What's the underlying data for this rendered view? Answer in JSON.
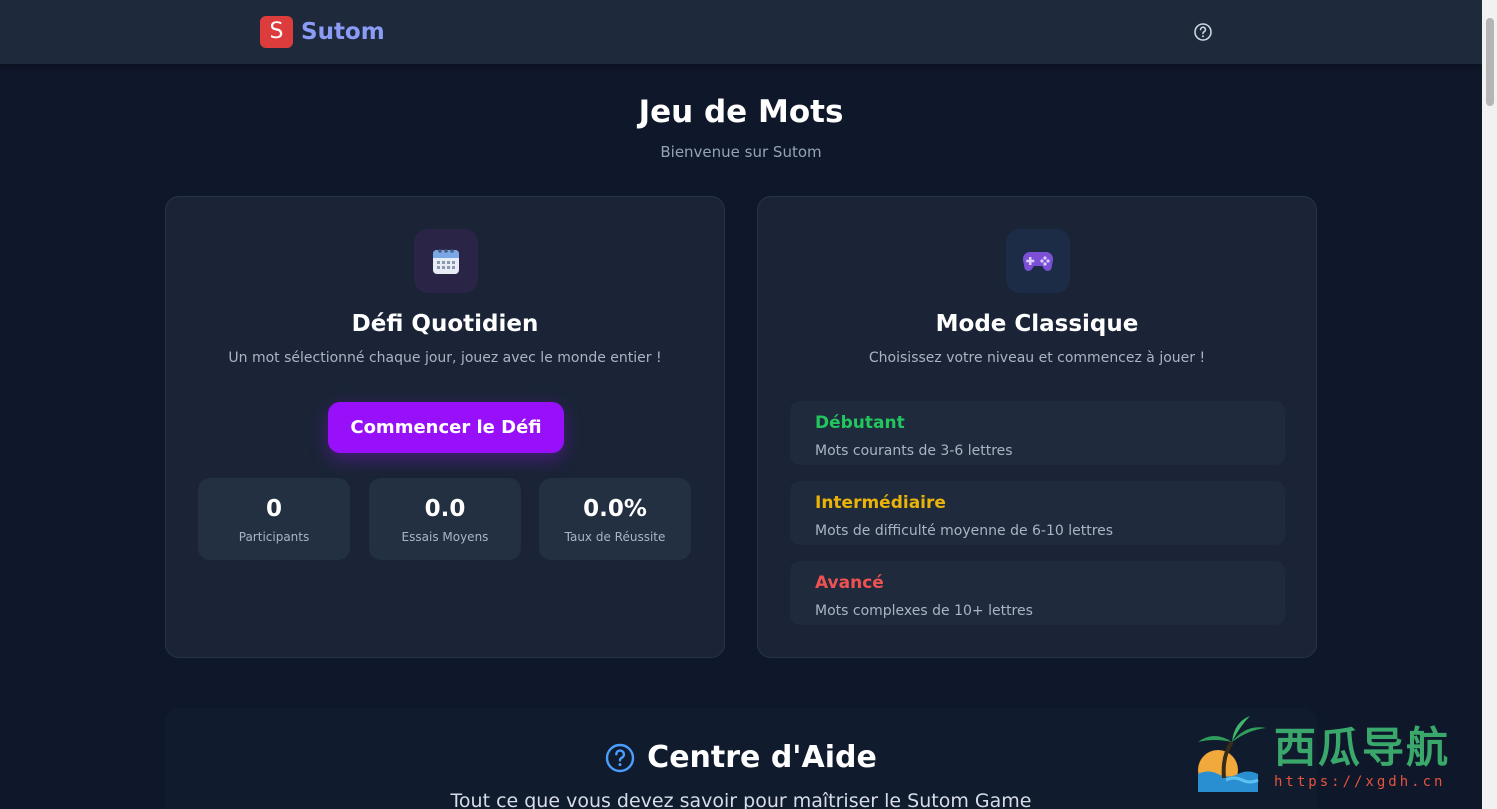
{
  "header": {
    "logo_letter": "S",
    "app_name": "Sutom"
  },
  "hero": {
    "title": "Jeu de Mots",
    "subtitle": "Bienvenue sur Sutom"
  },
  "daily": {
    "icon": "calendar-icon",
    "title": "Défi Quotidien",
    "description": "Un mot sélectionné chaque jour, jouez avec le monde entier !",
    "button_label": "Commencer le Défi",
    "stats": [
      {
        "value": "0",
        "label": "Participants"
      },
      {
        "value": "0.0",
        "label": "Essais Moyens"
      },
      {
        "value": "0.0%",
        "label": "Taux de Réussite"
      }
    ]
  },
  "classic": {
    "icon": "gamepad-icon",
    "title": "Mode Classique",
    "description": "Choisissez votre niveau et commencez à jouer !",
    "levels": [
      {
        "name": "Débutant",
        "description": "Mots courants de 3-6 lettres",
        "color": "#22c55e"
      },
      {
        "name": "Intermédiaire",
        "description": "Mots de difficulté moyenne de 6-10 lettres",
        "color": "#eab308"
      },
      {
        "name": "Avancé",
        "description": "Mots complexes de 10+ lettres",
        "color": "#f05252"
      }
    ]
  },
  "help": {
    "title": "Centre d'Aide",
    "subtitle": "Tout ce que vous devez savoir pour maîtriser le Sutom Game"
  },
  "watermark": {
    "text": "西瓜导航",
    "url": "https://xgdh.cn"
  },
  "colors": {
    "background": "#0f172a",
    "card": "#1a2436",
    "accent": "#9810fa",
    "logo": "#dc3c3c"
  }
}
